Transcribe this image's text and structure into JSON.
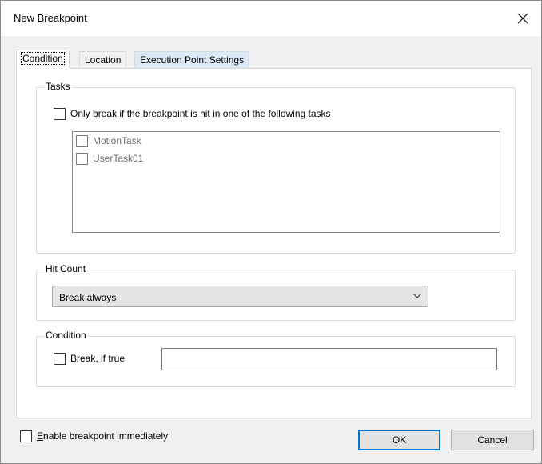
{
  "dialog": {
    "title": "New Breakpoint"
  },
  "tabs": [
    {
      "label": "Condition"
    },
    {
      "label": "Location"
    },
    {
      "label": "Execution Point Settings"
    }
  ],
  "tasks_group": {
    "label": "Tasks",
    "only_break_label": "Only break if the breakpoint is hit in one of the following tasks",
    "only_break_checked": false,
    "task_items": [
      {
        "label": "MotionTask",
        "checked": false
      },
      {
        "label": "UserTask01",
        "checked": false
      }
    ]
  },
  "hit_count_group": {
    "label": "Hit Count",
    "selected_value": "Break always"
  },
  "condition_group": {
    "label": "Condition",
    "break_if_true_label": "Break, if true",
    "break_if_true_checked": false,
    "expression_value": ""
  },
  "footer": {
    "enable_prefix": "",
    "enable_accel": "E",
    "enable_rest": "nable breakpoint immediately",
    "enable_checked": false,
    "ok_label": "OK",
    "cancel_label": "Cancel"
  }
}
